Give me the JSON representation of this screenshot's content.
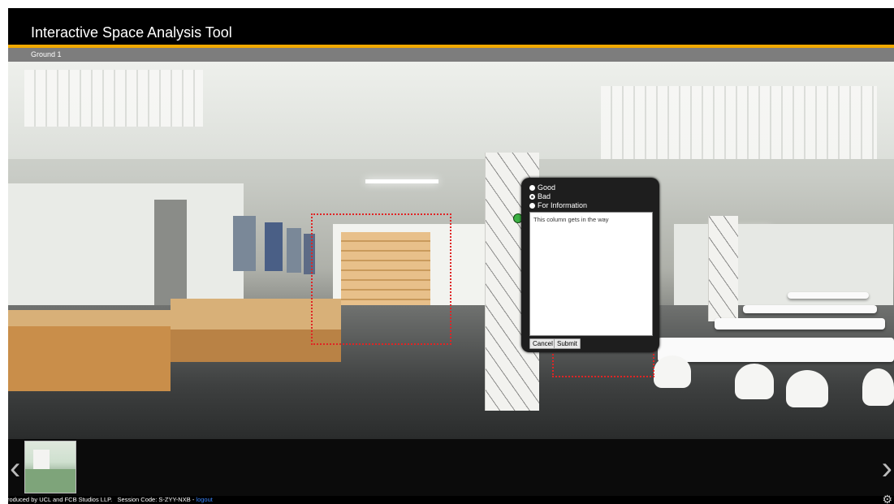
{
  "header": {
    "title": "Interactive Space Analysis Tool"
  },
  "location": {
    "label": "Ground 1"
  },
  "feedback": {
    "options": [
      {
        "label": "Good",
        "selected": false
      },
      {
        "label": "Bad",
        "selected": true
      },
      {
        "label": "For Information",
        "selected": false
      }
    ],
    "comment": "This column gets in the way",
    "cancel_label": "Cancel",
    "submit_label": "Submit"
  },
  "thumbnails": [
    {
      "icon": "panorama-thumbnail"
    }
  ],
  "nav": {
    "prev_icon": "chevron-left-icon",
    "next_icon": "chevron-right-icon"
  },
  "footer": {
    "credit": "Produced by UCL and FCB Studios LLP.",
    "session_label": "Session Code:",
    "session_code": "S-ZYY-NXB",
    "separator": "-",
    "logout_label": "logout"
  },
  "colors": {
    "accent": "#f0a800",
    "marker": "#e02424",
    "link": "#3a86ff"
  }
}
